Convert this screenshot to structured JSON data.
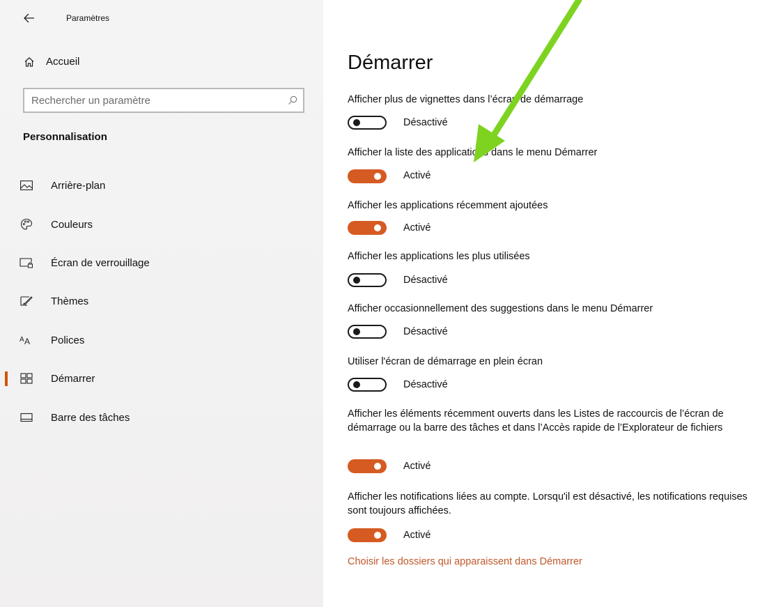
{
  "window": {
    "app_title": "Paramètres"
  },
  "sidebar": {
    "home_label": "Accueil",
    "search_placeholder": "Rechercher un paramètre",
    "section_title": "Personnalisation",
    "items": [
      {
        "label": "Arrière-plan",
        "icon": "picture-icon"
      },
      {
        "label": "Couleurs",
        "icon": "palette-icon"
      },
      {
        "label": "Écran de verrouillage",
        "icon": "lock-screen-icon"
      },
      {
        "label": "Thèmes",
        "icon": "themes-icon"
      },
      {
        "label": "Polices",
        "icon": "fonts-icon"
      },
      {
        "label": "Démarrer",
        "icon": "start-icon",
        "active": true
      },
      {
        "label": "Barre des tâches",
        "icon": "taskbar-icon"
      }
    ]
  },
  "main": {
    "title": "Démarrer",
    "settings": [
      {
        "label": "Afficher plus de vignettes dans l’écran de démarrage",
        "state": "Désactivé",
        "on": false
      },
      {
        "label": "Afficher la liste des applications dans le menu Démarrer",
        "state": "Activé",
        "on": true
      },
      {
        "label": "Afficher les applications récemment ajoutées",
        "state": "Activé",
        "on": true
      },
      {
        "label": "Afficher les applications les plus utilisées",
        "state": "Désactivé",
        "on": false
      },
      {
        "label": "Afficher occasionnellement des suggestions dans le menu Démarrer",
        "state": "Désactivé",
        "on": false
      },
      {
        "label": "Utiliser l'écran de démarrage en plein écran",
        "state": "Désactivé",
        "on": false
      },
      {
        "label": "Afficher les éléments récemment ouverts dans les Listes de raccourcis de l’écran de démarrage ou la barre des tâches et dans l’Accès rapide de l’Explorateur de fichiers",
        "state": "Activé",
        "on": true
      },
      {
        "label": "Afficher les notifications liées au compte. Lorsqu'il est désactivé, les notifications requises sont toujours affichées.",
        "state": "Activé",
        "on": true
      }
    ],
    "link": "Choisir les dossiers qui apparaissent dans Démarrer"
  },
  "colors": {
    "accent": "#d55b22",
    "link": "#c0582a",
    "annotation_arrow": "#7ed321"
  }
}
